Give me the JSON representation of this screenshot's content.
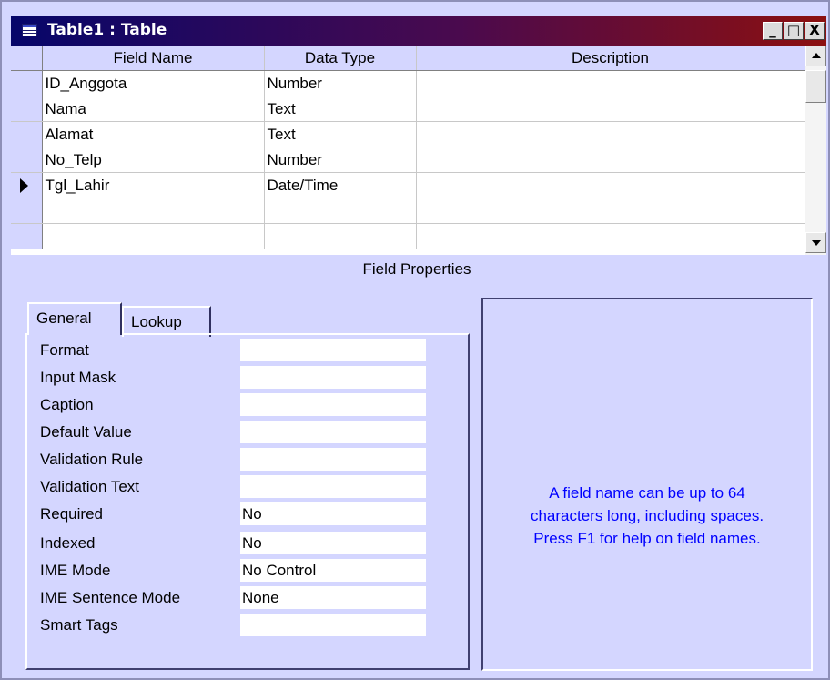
{
  "window": {
    "title": "Table1 : Table",
    "controls": {
      "minimize": "_",
      "maximize": "□",
      "close": "X"
    }
  },
  "grid": {
    "columns": [
      "Field Name",
      "Data Type",
      "Description"
    ],
    "rows": [
      {
        "field_name": "ID_Anggota",
        "data_type": "Number",
        "description": "",
        "current": false
      },
      {
        "field_name": "Nama",
        "data_type": "Text",
        "description": "",
        "current": false
      },
      {
        "field_name": "Alamat",
        "data_type": "Text",
        "description": "",
        "current": false
      },
      {
        "field_name": "No_Telp",
        "data_type": "Number",
        "description": "",
        "current": false
      },
      {
        "field_name": "Tgl_Lahir",
        "data_type": "Date/Time",
        "description": "",
        "current": true
      },
      {
        "field_name": "",
        "data_type": "",
        "description": "",
        "current": false
      },
      {
        "field_name": "",
        "data_type": "",
        "description": "",
        "current": false
      }
    ]
  },
  "field_properties": {
    "heading": "Field Properties",
    "tabs": [
      {
        "label": "General",
        "active": true
      },
      {
        "label": "Lookup",
        "active": false
      }
    ],
    "properties": [
      {
        "label": "Format",
        "value": ""
      },
      {
        "label": "Input Mask",
        "value": ""
      },
      {
        "label": "Caption",
        "value": ""
      },
      {
        "label": "Default Value",
        "value": ""
      },
      {
        "label": "Validation Rule",
        "value": ""
      },
      {
        "label": "Validation Text",
        "value": ""
      },
      {
        "label": "Required",
        "value": "No"
      },
      {
        "label": "Indexed",
        "value": "No"
      },
      {
        "label": "IME Mode",
        "value": "No Control"
      },
      {
        "label": "IME Sentence Mode",
        "value": "None"
      },
      {
        "label": "Smart Tags",
        "value": ""
      }
    ],
    "help_text": "A field name can be up to 64\ncharacters long, including spaces.\nPress F1 for help on field names."
  },
  "colors": {
    "panel_bg": "#d4d6ff",
    "help_text": "#0000ff",
    "title_start": "#06066a",
    "title_end": "#8c1010"
  }
}
